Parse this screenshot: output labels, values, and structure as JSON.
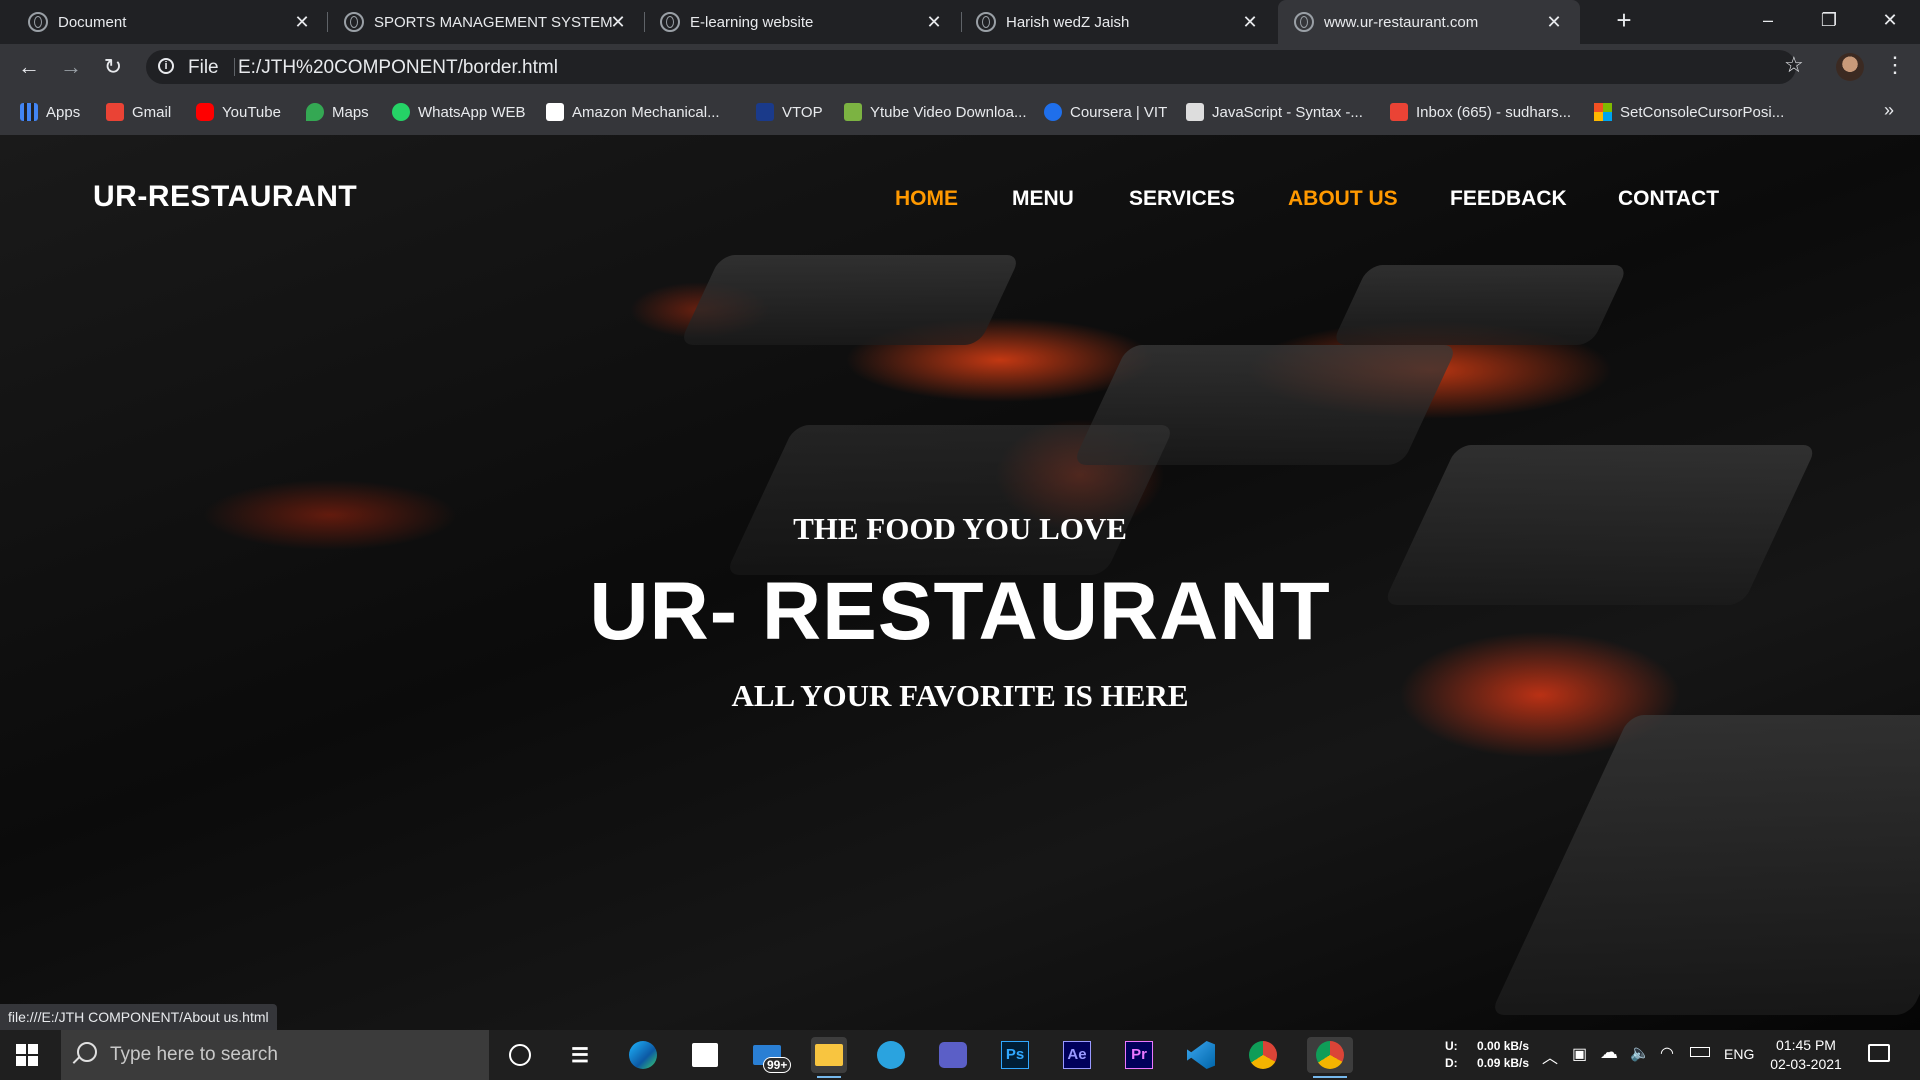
{
  "browser": {
    "tabs": [
      {
        "label": "Document"
      },
      {
        "label": "SPORTS MANAGEMENT SYSTEM"
      },
      {
        "label": "E-learning website"
      },
      {
        "label": "Harish wedZ Jaish"
      },
      {
        "label": "www.ur-restaurant.com"
      }
    ],
    "new_tab": "+",
    "window_controls": {
      "minimize": "–",
      "restore": "❐",
      "close": "✕"
    },
    "nav": {
      "back": "←",
      "forward": "→",
      "reload": "↻"
    },
    "address": {
      "scheme": "File",
      "url": "E:/JTH%20COMPONENT/border.html"
    },
    "bookmarks": [
      {
        "label": "Apps",
        "icon": "apps-grid-icon",
        "color": "#4285f4"
      },
      {
        "label": "Gmail",
        "icon": "gmail-icon",
        "color": "#ea4335"
      },
      {
        "label": "YouTube",
        "icon": "youtube-icon",
        "color": "#ff0000"
      },
      {
        "label": "Maps",
        "icon": "maps-pin-icon",
        "color": "#34a853"
      },
      {
        "label": "WhatsApp WEB",
        "icon": "whatsapp-icon",
        "color": "#25d366"
      },
      {
        "label": "Amazon Mechanical...",
        "icon": "amazon-icon",
        "color": "#ffffff"
      },
      {
        "label": "VTOP",
        "icon": "vtop-icon",
        "color": "#1a3a8a"
      },
      {
        "label": "Ytube Video Downloa...",
        "icon": "download-arrow-icon",
        "color": "#7cb342"
      },
      {
        "label": "Coursera | VIT",
        "icon": "coursera-icon",
        "color": "#1f6feb"
      },
      {
        "label": "JavaScript - Syntax -...",
        "icon": "javascript-icon",
        "color": "#dddddd"
      },
      {
        "label": "Inbox (665) - sudhars...",
        "icon": "gmail-icon",
        "color": "#ea4335"
      },
      {
        "label": "SetConsoleCursorPosi...",
        "icon": "microsoft-icon",
        "color": "#f25022"
      }
    ],
    "bookmarks_overflow": "»",
    "status_url": "file:///E:/JTH COMPONENT/About us.html"
  },
  "site": {
    "logo": "UR-RESTAURANT",
    "nav": [
      "HOME",
      "MENU",
      "SERVICES",
      "ABOUT US",
      "FEEDBACK",
      "CONTACT"
    ],
    "hero": {
      "tagline": "THE FOOD YOU LOVE",
      "title": "UR- RESTAURANT",
      "subtitle": "ALL YOUR FAVORITE IS HERE"
    },
    "colors": {
      "accent": "#ff9900",
      "text": "#ffffff"
    }
  },
  "taskbar": {
    "search_placeholder": "Type here to search",
    "mail_badge": "99+",
    "apps": [
      "cortana-icon",
      "task-view-icon",
      "edge-icon",
      "store-icon",
      "mail-icon",
      "file-explorer-icon",
      "telegram-icon",
      "teams-icon",
      "photoshop-icon",
      "after-effects-icon",
      "premiere-icon",
      "vscode-icon",
      "chrome-icon",
      "chrome-active-icon"
    ],
    "app_labels": {
      "photoshop": "Ps",
      "after_effects": "Ae",
      "premiere": "Pr"
    },
    "net": {
      "up_label": "U:",
      "up": "0.00 kB/s",
      "down_label": "D:",
      "down": "0.09 kB/s"
    },
    "language": "ENG",
    "time": "01:45 PM",
    "date": "02-03-2021"
  }
}
